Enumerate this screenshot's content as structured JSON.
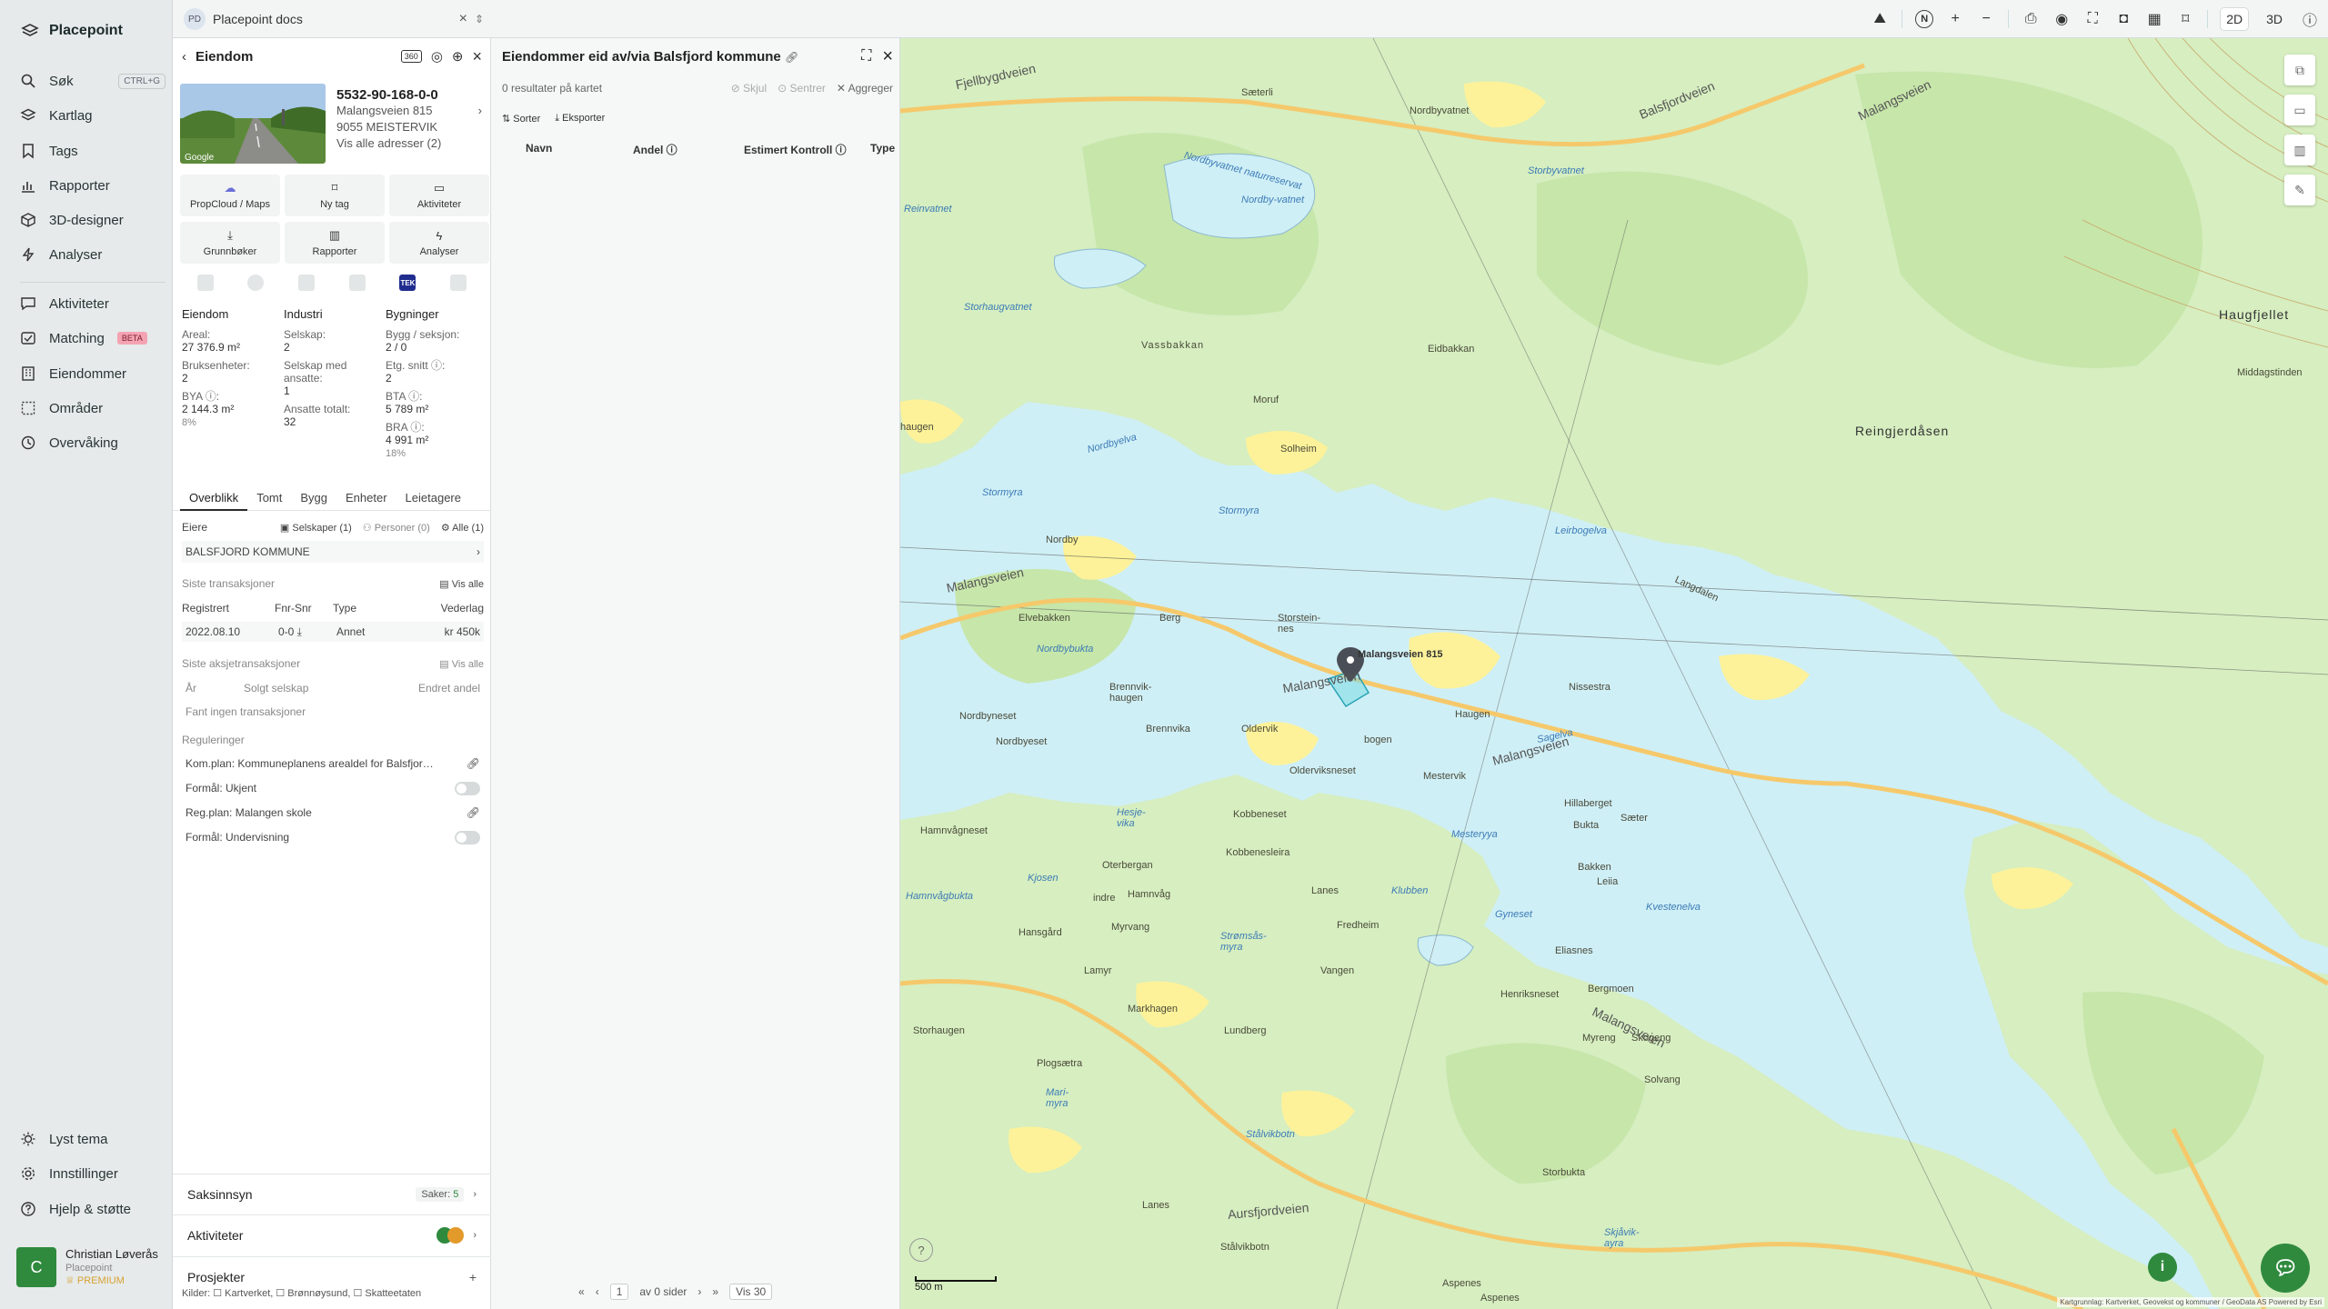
{
  "app": {
    "name": "Placepoint"
  },
  "nav": {
    "search": {
      "label": "Søk",
      "shortcut": "CTRL+G"
    },
    "items": [
      {
        "label": "Kartlag",
        "icon": "layers-icon"
      },
      {
        "label": "Tags",
        "icon": "bookmark-icon"
      },
      {
        "label": "Rapporter",
        "icon": "bar-chart-icon"
      },
      {
        "label": "3D-designer",
        "icon": "cube-icon"
      },
      {
        "label": "Analyser",
        "icon": "bolt-icon"
      }
    ],
    "items2": [
      {
        "label": "Aktiviteter",
        "icon": "chat-icon"
      },
      {
        "label": "Matching",
        "icon": "match-icon",
        "badge": "BETA"
      },
      {
        "label": "Eiendommer",
        "icon": "building-icon"
      },
      {
        "label": "Områder",
        "icon": "area-icon"
      },
      {
        "label": "Overvåking",
        "icon": "clock-icon"
      }
    ],
    "bottom": [
      {
        "label": "Lyst tema",
        "icon": "sun-icon"
      },
      {
        "label": "Innstillinger",
        "icon": "gear-icon"
      },
      {
        "label": "Hjelp & støtte",
        "icon": "help-icon"
      }
    ],
    "user": {
      "initial": "C",
      "name": "Christian Løverås",
      "org": "Placepoint",
      "plan": "PREMIUM"
    }
  },
  "topbar": {
    "search_badge": "PD",
    "search_value": "Placepoint docs",
    "modes": [
      "2D",
      "3D"
    ],
    "active_mode": "2D"
  },
  "property": {
    "title": "Eiendom",
    "badge": "360",
    "gnr": "5532-90-168-0-0",
    "street": "Malangsveien 815",
    "postal": "9055 MEISTERVIK",
    "all_addresses": "Vis alle adresser (2)",
    "photo_label": "Google",
    "actions": [
      {
        "label": "PropCloud / Maps",
        "icon": "cloud-icon"
      },
      {
        "label": "Ny tag",
        "icon": "bookmark-icon"
      },
      {
        "label": "Aktiviteter",
        "icon": "chat-icon"
      },
      {
        "label": "Grunnbøker",
        "icon": "download-icon"
      },
      {
        "label": "Rapporter",
        "icon": "bar-chart-icon"
      },
      {
        "label": "Analyser",
        "icon": "bolt-icon"
      }
    ],
    "tek": "TEK",
    "facts": {
      "eiendom": {
        "title": "Eiendom",
        "areal_k": "Areal:",
        "areal_v": "27 376.9 m²",
        "bruk_k": "Bruksenheter:",
        "bruk_v": "2",
        "bya_k": "BYA ⓘ:",
        "bya_v": "2 144.3 m²",
        "bya_p": "8%"
      },
      "industri": {
        "title": "Industri",
        "selskap_k": "Selskap:",
        "selskap_v": "2",
        "ansatte_k": "Selskap med ansatte:",
        "ansatte_v": "1",
        "tot_k": "Ansatte totalt:",
        "tot_v": "32"
      },
      "bygninger": {
        "title": "Bygninger",
        "bygg_k": "Bygg / seksjon:",
        "bygg_v": "2 / 0",
        "etg_k": "Etg. snitt ⓘ:",
        "etg_v": "2",
        "bta_k": "BTA ⓘ:",
        "bta_v": "5 789 m²",
        "bra_k": "BRA ⓘ:",
        "bra_v": "4 991 m²",
        "bra_p": "18%"
      }
    },
    "tabs": [
      "Overblikk",
      "Tomt",
      "Bygg",
      "Enheter",
      "Leietagere"
    ],
    "active_tab": "Overblikk",
    "owners": {
      "label": "Eiere",
      "selskaper": "Selskaper (1)",
      "personer": "Personer (0)",
      "alle": "Alle (1)",
      "owner_name": "BALSFJORD KOMMUNE"
    },
    "transactions": {
      "label": "Siste transaksjoner",
      "show_all": "Vis alle",
      "headers": [
        "Registrert",
        "Fnr-Snr",
        "Type",
        "Vederlag"
      ],
      "rows": [
        [
          "2022.08.10",
          "0-0 ⤓",
          "Annet",
          "kr 450k"
        ]
      ]
    },
    "share_transactions": {
      "label": "Siste aksjetransaksjoner",
      "show_all": "Vis alle",
      "headers": [
        "År",
        "Solgt selskap",
        "Endret andel"
      ],
      "empty": "Fant ingen transaksjoner"
    },
    "regulations": {
      "label": "Reguleringer",
      "items": [
        {
          "text": "Kom.plan: Kommuneplanens arealdel for Balsfjor…",
          "kind": "link"
        },
        {
          "text": "Formål: Ukjent",
          "kind": "toggle"
        },
        {
          "text": "Reg.plan: Malangen skole",
          "kind": "link"
        },
        {
          "text": "Formål: Undervisning",
          "kind": "toggle"
        }
      ]
    },
    "sections": {
      "saksinnsyn": "Saksinnsyn",
      "saker_label": "Saker:",
      "saker_count": "5",
      "aktiviteter": "Aktiviteter",
      "prosjekter": "Prosjekter"
    },
    "sources": "Kilder: ☐ Kartverket, ☐ Brønnøysund, ☐ Skatteetaten"
  },
  "results": {
    "title": "Eiendommer eid av/via Balsfjord kommune",
    "count_text": "0 resultater på kartet",
    "hide": "Skjul",
    "center": "Sentrer",
    "aggregate": "Aggreger",
    "sort": "Sorter",
    "export": "Eksporter",
    "columns": [
      "Navn",
      "Andel ⓘ",
      "Estimert Kontroll ⓘ",
      "Type"
    ],
    "pager": {
      "page": "1",
      "of": "av 0 sider",
      "show": "Vis 30"
    }
  },
  "map": {
    "scale": "500 m",
    "credit": "Kartgrunnlag: Kartverket, Geovekst og kommuner / GeoData AS Powered by Esri",
    "pin_label": "Malangsveien 815",
    "labels": {
      "fjellbygdveien": "Fjellbygdveien",
      "saeterli": "Sæterli",
      "nordbyvatnet": "Nordbyvatnet",
      "balsfjordveien": "Balsfjordveien",
      "malangsveien_top": "Malangsveien",
      "nordbyvatnet_nr": "Nordbyvatnet naturreservat",
      "storbyvatnet": "Storbyvatnet",
      "reinvatnet": "Reinvatnet",
      "nordbyvatnet_lake": "Nordby-vatnet",
      "storhaugvatnet": "Storhaugvatnet",
      "vassbakkan": "Vassbakkan",
      "eidbakkan": "Eidbakkan",
      "haugfjellet": "Haugfjellet",
      "middagstinden": "Middagstinden",
      "reingjerdasen": "Reingjerdåsen",
      "moruf": "Moruf",
      "solheim": "Solheim",
      "haugen": "haugen",
      "nordbyelva": "Nordbyelva",
      "stormyra1": "Stormyra",
      "stormyra2": "Stormyra",
      "nordby": "Nordby",
      "leirbogelva": "Leirbogelva",
      "langdalen": "Langdalen",
      "malangsveien_w": "Malangsveien",
      "elvebakken": "Elvebakken",
      "berg": "Berg",
      "storsteinnes": "Storstein-nes",
      "malangsveien_c": "Malangsveien",
      "nordbybukta": "Nordbybukta",
      "brennvikhaugen": "Brennvik-haugen",
      "nissestra": "Nissestra",
      "nordbyneset": "Nordbyneset",
      "nordbyeset2": "Nordbyeset",
      "brennvika": "Brennvika",
      "oldervik": "Oldervik",
      "haugen2": "Haugen",
      "malangsveien_e": "Malangsveien",
      "bogen": "bogen",
      "olderviksneset": "Olderviksneset",
      "mestervik": "Mestervik",
      "sagelva": "Sagelva",
      "hillaberget": "Hillaberget",
      "hamnvagneset": "Hamnvågneset",
      "hesjevika": "Hesje-vika",
      "kobbeneset": "Kobbeneset",
      "kobbenesleira": "Kobbenesleira",
      "mestervya": "Mesteryya",
      "saeter": "Sæter",
      "bukta": "Bukta",
      "kjosen": "Kjosen",
      "oterbergan": "Oterbergan",
      "bakken": "Bakken",
      "hamnvagbukta": "Hamnvågbukta",
      "indre": "indre",
      "hamnvag": "Hamnvåg",
      "lanes": "Lanes",
      "klubben": "Klubben",
      "leiia": "Leiia",
      "gyneset": "Gyneset",
      "kvestenelva": "Kvestenelva",
      "hansgard": "Hansgård",
      "myrvang": "Myrvang",
      "fredheim": "Fredheim",
      "stramsasmyra": "Strømsås-myra",
      "eliasnes": "Eliasnes",
      "lamyr": "Lamyr",
      "vangen": "Vangen",
      "bergmoen": "Bergmoen",
      "henriksneset": "Henriksneset",
      "markhagen": "Markhagen",
      "storhaugen": "Storhaugen",
      "lundberg": "Lundberg",
      "malangsveien_se": "Malangsveien",
      "skogeng": "Skogeng",
      "myreng": "Myreng",
      "plogsaetra": "Plogsætra",
      "solvang": "Solvang",
      "marimyra": "Mari-myra",
      "stalvikbotn": "Stålvikbotn",
      "storbukta": "Storbukta",
      "lanes2": "Lanes",
      "aursfjordveien": "Aursfjordveien",
      "stalvikbotn2": "Stålvikbotn",
      "skjavikayra": "Skjåvik-ayra",
      "aspenes": "Aspenes",
      "aspenes2": "Aspenes"
    }
  },
  "colors": {
    "accent": "#2f8a3e",
    "water": "#cfeff6",
    "land": "#d6eec0",
    "forest": "#c7e6aa",
    "farmland": "#fdf29a",
    "road_main": "#f5c96b"
  }
}
